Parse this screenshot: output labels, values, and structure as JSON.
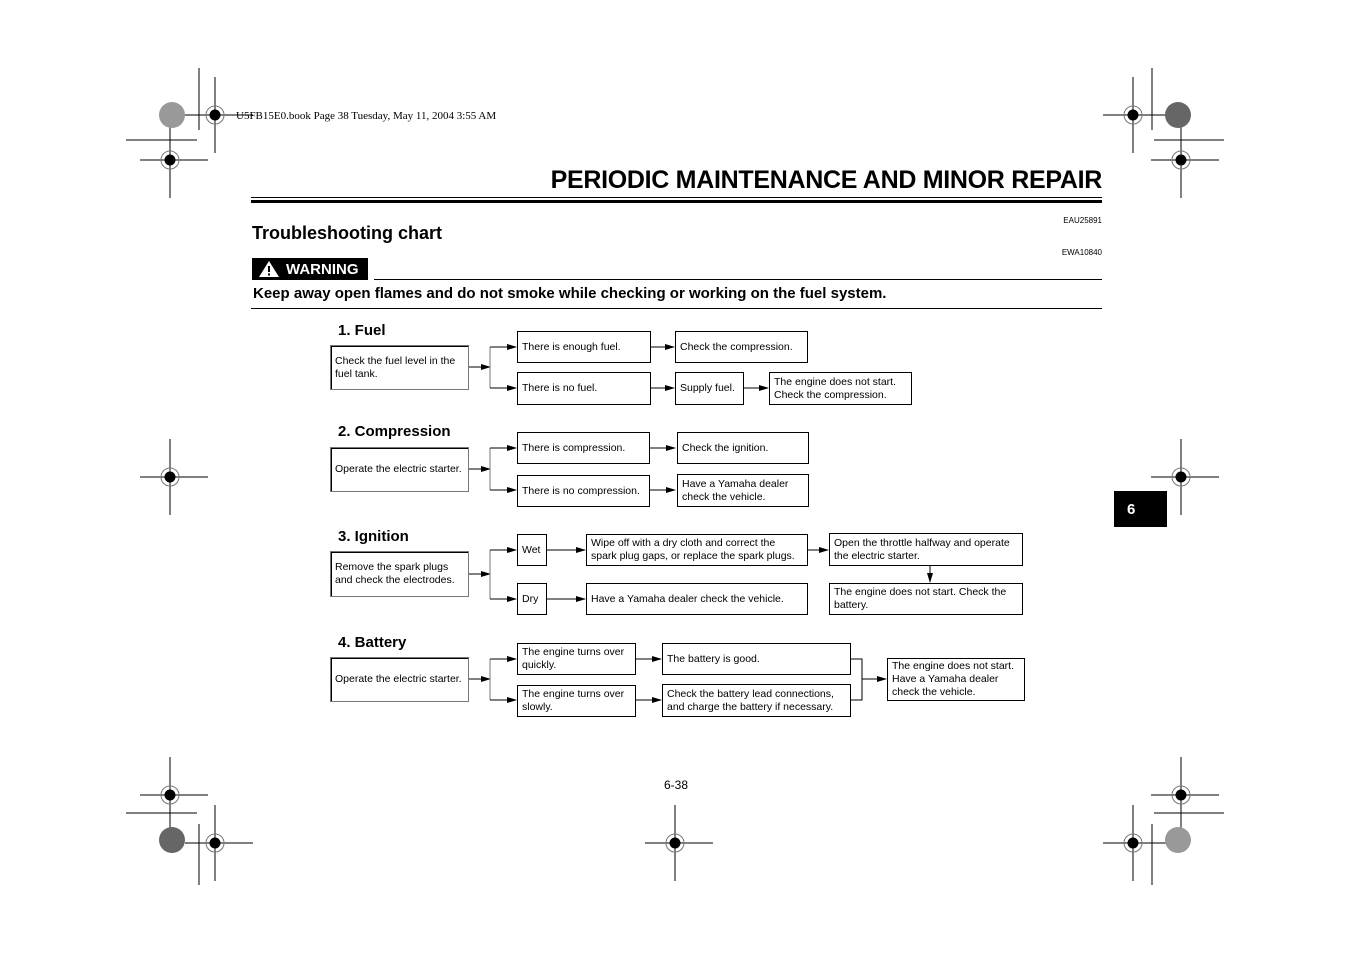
{
  "header": {
    "meta": "U5FB15E0.book  Page 38  Tuesday, May 11, 2004  3:55 AM",
    "chapter_title": "PERIODIC MAINTENANCE AND MINOR REPAIR",
    "chapter_tab": "6"
  },
  "section": {
    "title": "Troubleshooting chart",
    "code": "EAU25891"
  },
  "warning": {
    "code": "EWA10840",
    "label": "WARNING",
    "icon": "warning-triangle-icon",
    "text": "Keep away open flames and do not smoke while checking or working on the fuel system."
  },
  "steps": [
    {
      "title": "1. Fuel",
      "start": "Check the fuel level in the fuel tank.",
      "branches": [
        {
          "condition": "There is enough fuel.",
          "actions": [
            "Check the compression."
          ]
        },
        {
          "condition": "There is no fuel.",
          "actions": [
            "Supply fuel.",
            "The engine does not start. Check the compression."
          ]
        }
      ]
    },
    {
      "title": "2. Compression",
      "start": "Operate the electric starter.",
      "branches": [
        {
          "condition": "There is compression.",
          "actions": [
            "Check the ignition."
          ]
        },
        {
          "condition": "There is no compression.",
          "actions": [
            "Have a Yamaha dealer check the vehicle."
          ]
        }
      ]
    },
    {
      "title": "3. Ignition",
      "start": "Remove the spark plugs and check the electrodes.",
      "branches": [
        {
          "condition": "Wet",
          "actions": [
            "Wipe off with a dry cloth and correct the spark plug gaps, or replace the spark plugs.",
            "Open the throttle halfway and operate the electric starter.",
            "The engine does not start. Check the battery."
          ]
        },
        {
          "condition": "Dry",
          "actions": [
            "Have a Yamaha dealer check the vehicle."
          ]
        }
      ]
    },
    {
      "title": "4. Battery",
      "start": "Operate the electric starter.",
      "branches": [
        {
          "condition": "The engine turns over quickly.",
          "actions": [
            "The battery is good."
          ]
        },
        {
          "condition": "The engine turns over slowly.",
          "actions": [
            "Check the battery lead connections, and charge the battery if necessary."
          ]
        }
      ],
      "merge": "The engine does not start. Have a Yamaha dealer check the vehicle."
    }
  ],
  "footer": {
    "page_number": "6-38"
  }
}
